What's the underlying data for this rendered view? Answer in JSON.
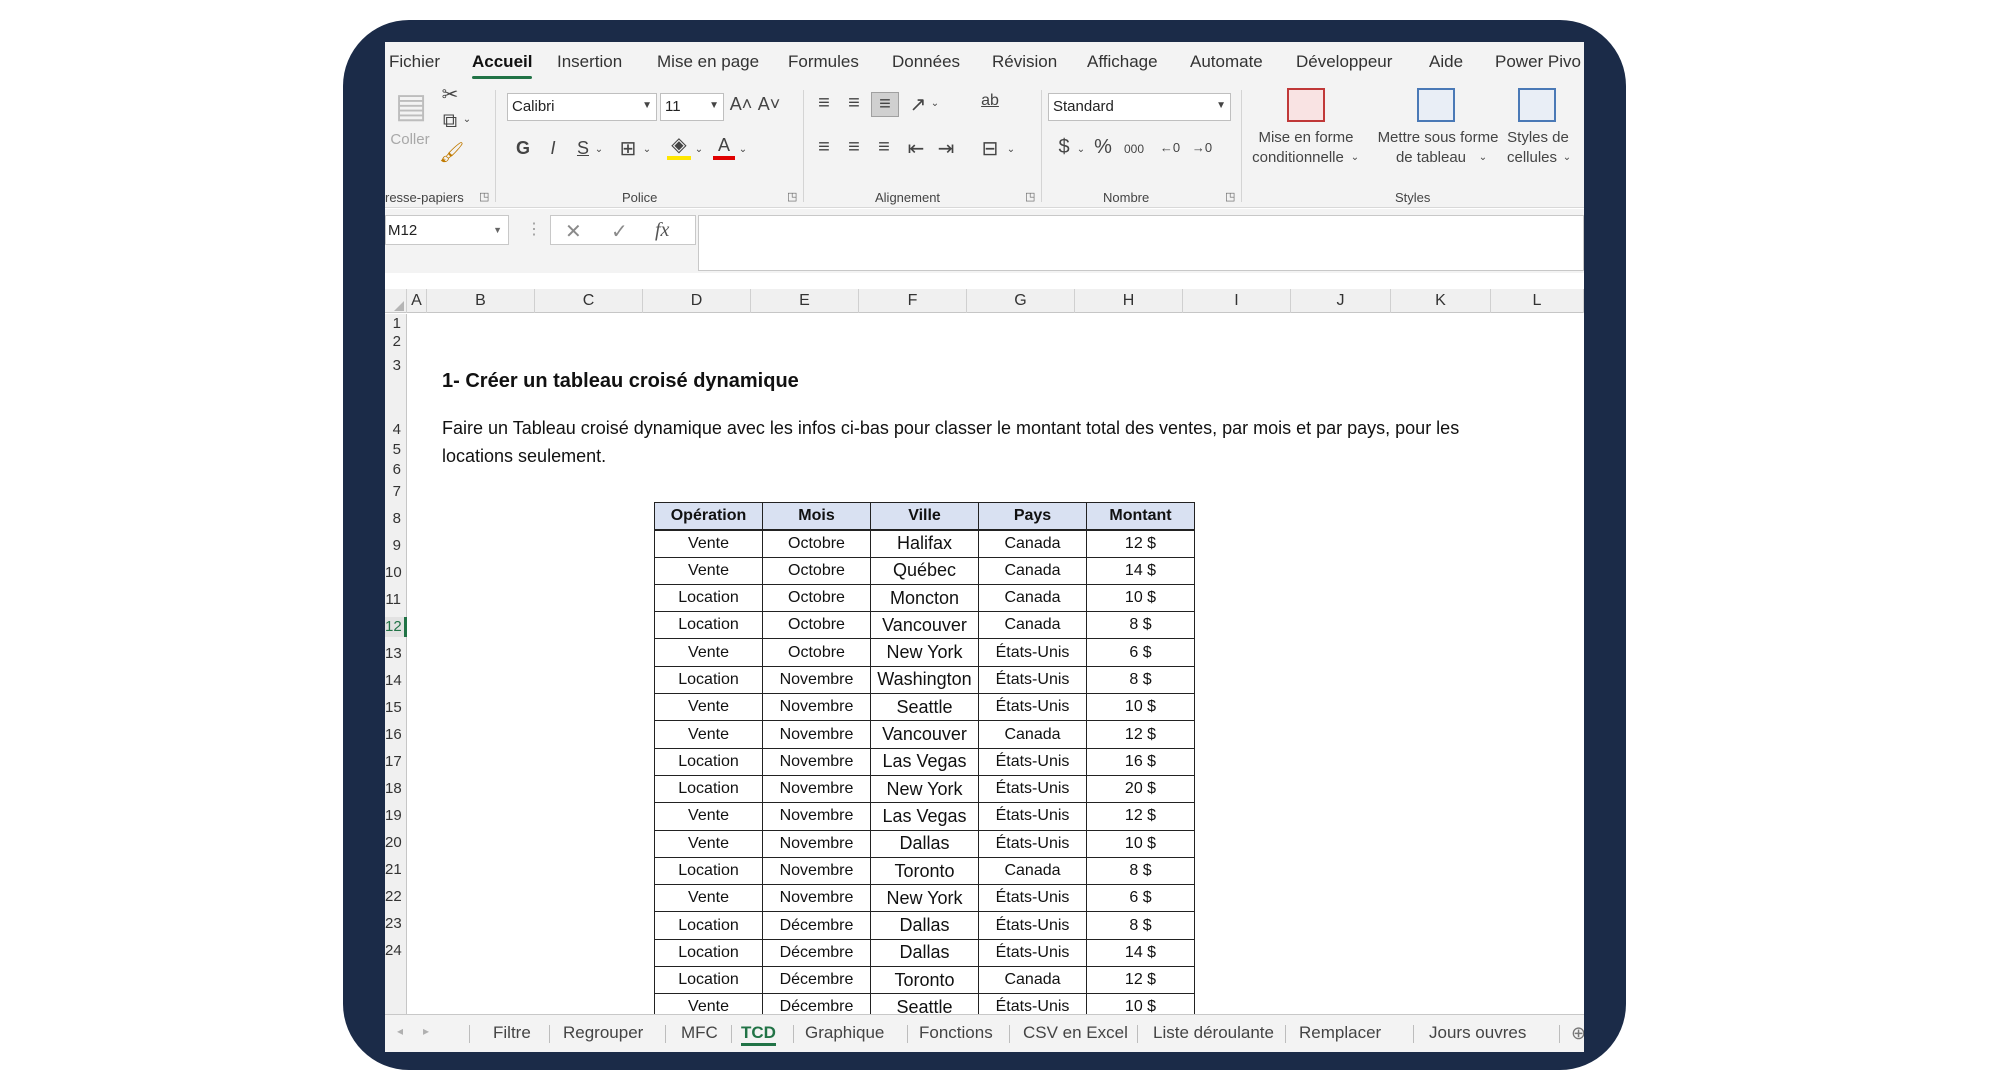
{
  "menu": [
    "Fichier",
    "Accueil",
    "Insertion",
    "Mise en page",
    "Formules",
    "Données",
    "Révision",
    "Affichage",
    "Automate",
    "Développeur",
    "Aide",
    "Power Pivo"
  ],
  "ribbon": {
    "clipboard": {
      "paste_label": "Coller",
      "group_label": "resse-papiers"
    },
    "font": {
      "name": "Calibri",
      "size": "11",
      "bold": "G",
      "italic": "I",
      "underline": "S",
      "color_letter": "A",
      "group_label": "Police",
      "grow": "A˄",
      "shrink": "A˅"
    },
    "alignment": {
      "group_label": "Alignement",
      "wrap_icon": "ab",
      "merge_icon": "⇔"
    },
    "number": {
      "format": "Standard",
      "currency": "$",
      "percent": "%",
      "thousands": "000",
      "inc_dec": "←0",
      "dec_dec": "→0",
      "group_label": "Nombre"
    },
    "styles": {
      "cond_format_1": "Mise en forme",
      "cond_format_2": "conditionnelle",
      "table_format_1": "Mettre sous forme",
      "table_format_2": "de tableau",
      "cell_styles_1": "Styles de",
      "cell_styles_2": "cellules",
      "group_label": "Styles"
    }
  },
  "formula_bar": {
    "cell_ref": "M12",
    "cancel": "✕",
    "enter": "✓",
    "fx": "fx",
    "value": ""
  },
  "columns": [
    "A",
    "B",
    "C",
    "D",
    "E",
    "F",
    "G",
    "H",
    "I",
    "J",
    "K",
    "L"
  ],
  "rows": [
    "1",
    "2",
    "3",
    "4",
    "5",
    "6",
    "7",
    "8",
    "9",
    "10",
    "11",
    "12",
    "13",
    "14",
    "15",
    "16",
    "17",
    "18",
    "19",
    "20",
    "21",
    "22",
    "23",
    "24"
  ],
  "selected_row": "12",
  "heading": "1- Créer un tableau croisé dynamique",
  "paragraph": "Faire un Tableau croisé dynamique avec les infos ci-bas pour classer le montant total des ventes, par mois et par pays, pour les locations seulement.",
  "table": {
    "headers": [
      "Opération",
      "Mois",
      "Ville",
      "Pays",
      "Montant"
    ],
    "rows": [
      [
        "Vente",
        "Octobre",
        "Halifax",
        "Canada",
        "12 $"
      ],
      [
        "Vente",
        "Octobre",
        "Québec",
        "Canada",
        "14 $"
      ],
      [
        "Location",
        "Octobre",
        "Moncton",
        "Canada",
        "10 $"
      ],
      [
        "Location",
        "Octobre",
        "Vancouver",
        "Canada",
        "8 $"
      ],
      [
        "Vente",
        "Octobre",
        "New York",
        "États-Unis",
        "6 $"
      ],
      [
        "Location",
        "Novembre",
        "Washington",
        "États-Unis",
        "8 $"
      ],
      [
        "Vente",
        "Novembre",
        "Seattle",
        "États-Unis",
        "10 $"
      ],
      [
        "Vente",
        "Novembre",
        "Vancouver",
        "Canada",
        "12 $"
      ],
      [
        "Location",
        "Novembre",
        "Las Vegas",
        "États-Unis",
        "16 $"
      ],
      [
        "Location",
        "Novembre",
        "New York",
        "États-Unis",
        "20 $"
      ],
      [
        "Vente",
        "Novembre",
        "Las Vegas",
        "États-Unis",
        "12 $"
      ],
      [
        "Vente",
        "Novembre",
        "Dallas",
        "États-Unis",
        "10 $"
      ],
      [
        "Location",
        "Novembre",
        "Toronto",
        "Canada",
        "8 $"
      ],
      [
        "Vente",
        "Novembre",
        "New York",
        "États-Unis",
        "6 $"
      ],
      [
        "Location",
        "Décembre",
        "Dallas",
        "États-Unis",
        "8 $"
      ],
      [
        "Location",
        "Décembre",
        "Dallas",
        "États-Unis",
        "14 $"
      ],
      [
        "Location",
        "Décembre",
        "Toronto",
        "Canada",
        "12 $"
      ],
      [
        "Vente",
        "Décembre",
        "Seattle",
        "États-Unis",
        "10 $"
      ]
    ]
  },
  "sheet_tabs": [
    "Filtre",
    "Regrouper",
    "MFC",
    "TCD",
    "Graphique",
    "Fonctions",
    "CSV en Excel",
    "Liste déroulante",
    "Remplacer",
    "Jours ouvres"
  ],
  "active_tab": "TCD",
  "colors": {
    "frame": "#1b2b48",
    "accent": "#217346",
    "header_fill": "#d9e1f2"
  }
}
